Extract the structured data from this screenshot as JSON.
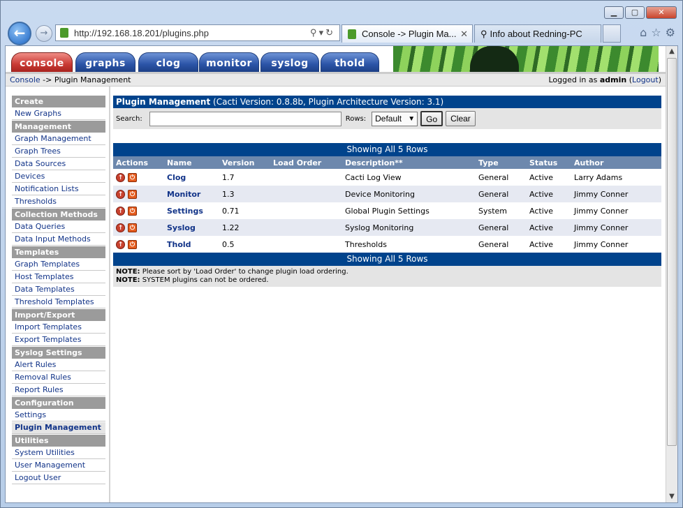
{
  "browser": {
    "url": "http://192.168.18.201/plugins.php",
    "tabs": [
      {
        "label": "Console -> Plugin Ma..."
      },
      {
        "label": "Info about Redning-PC"
      }
    ],
    "window_buttons": {
      "minimize": "▁",
      "maximize": "▢",
      "close": "✕"
    }
  },
  "cacti": {
    "nav_tabs": [
      "console",
      "graphs",
      "clog",
      "monitor",
      "syslog",
      "thold"
    ],
    "breadcrumb": {
      "root": "Console",
      "sep": " -> ",
      "current": "Plugin Management"
    },
    "login": {
      "prefix": "Logged in as ",
      "user": "admin",
      "logout": "Logout"
    }
  },
  "menu": [
    {
      "header": "Create",
      "items": [
        "New Graphs"
      ]
    },
    {
      "header": "Management",
      "items": [
        "Graph Management",
        "Graph Trees",
        "Data Sources",
        "Devices",
        "Notification Lists",
        "Thresholds"
      ]
    },
    {
      "header": "Collection Methods",
      "items": [
        "Data Queries",
        "Data Input Methods"
      ]
    },
    {
      "header": "Templates",
      "items": [
        "Graph Templates",
        "Host Templates",
        "Data Templates",
        "Threshold Templates"
      ]
    },
    {
      "header": "Import/Export",
      "items": [
        "Import Templates",
        "Export Templates"
      ]
    },
    {
      "header": "Syslog Settings",
      "items": [
        "Alert Rules",
        "Removal Rules",
        "Report Rules"
      ]
    },
    {
      "header": "Configuration",
      "items": [
        "Settings",
        "Plugin Management"
      ]
    },
    {
      "header": "Utilities",
      "items": [
        "System Utilities",
        "User Management",
        "Logout User"
      ]
    }
  ],
  "selected_menu_item": "Plugin Management",
  "main": {
    "title_bold": "Plugin Management",
    "title_rest": " (Cacti Version: 0.8.8b, Plugin Architecture Version: 3.1)",
    "search_label": "Search:",
    "search_value": "",
    "rows_label": "Rows:",
    "rows_value": "Default",
    "go_label": "Go",
    "clear_label": "Clear",
    "showing": "Showing All 5 Rows",
    "columns": [
      "Actions",
      "Name",
      "Version",
      "Load Order",
      "Description**",
      "Type",
      "Status",
      "Author"
    ],
    "rows": [
      {
        "name": "Clog",
        "version": "1.7",
        "load_order": "",
        "description": "Cacti Log View",
        "type": "General",
        "status": "Active",
        "author": "Larry Adams"
      },
      {
        "name": "Monitor",
        "version": "1.3",
        "load_order": "",
        "description": "Device Monitoring",
        "type": "General",
        "status": "Active",
        "author": "Jimmy Conner"
      },
      {
        "name": "Settings",
        "version": "0.71",
        "load_order": "",
        "description": "Global Plugin Settings",
        "type": "System",
        "status": "Active",
        "author": "Jimmy Conner"
      },
      {
        "name": "Syslog",
        "version": "1.22",
        "load_order": "",
        "description": "Syslog Monitoring",
        "type": "General",
        "status": "Active",
        "author": "Jimmy Conner"
      },
      {
        "name": "Thold",
        "version": "0.5",
        "load_order": "",
        "description": "Thresholds",
        "type": "General",
        "status": "Active",
        "author": "Jimmy Conner"
      }
    ],
    "notes": [
      {
        "label": "NOTE:",
        "text": " Please sort by 'Load Order' to change plugin load ordering."
      },
      {
        "label": "NOTE:",
        "text": " SYSTEM plugins can not be ordered."
      }
    ]
  }
}
